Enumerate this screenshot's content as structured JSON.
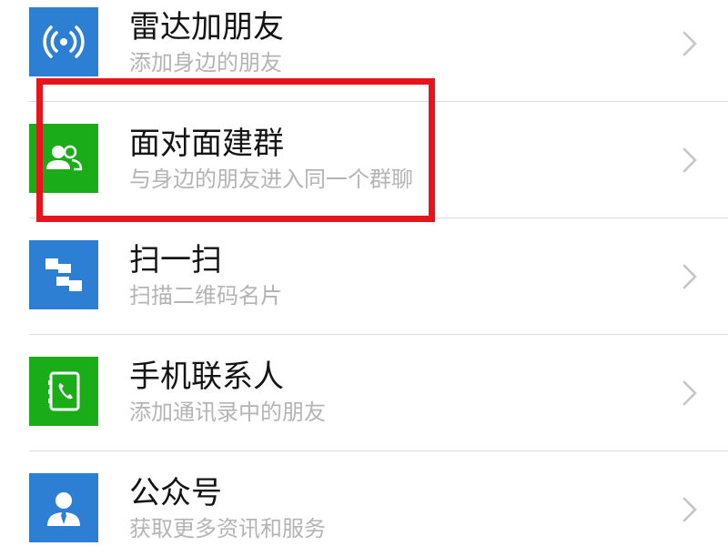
{
  "colors": {
    "blue_tile": "#2d7fd4",
    "green_tile": "#1aad19",
    "annotation_red": "#e8141b",
    "title_text": "#141414",
    "subtitle_text": "#b4b4b4",
    "divider": "#dcdcdc",
    "chevron": "#c6c6c6"
  },
  "items": [
    {
      "title": "雷达加朋友",
      "subtitle": "添加身边的朋友",
      "icon": "radar-icon",
      "icon_color": "#2d7fd4"
    },
    {
      "title": "面对面建群",
      "subtitle": "与身边的朋友进入同一个群聊",
      "icon": "face-to-face-group-icon",
      "icon_color": "#1aad19",
      "highlighted": true
    },
    {
      "title": "扫一扫",
      "subtitle": "扫描二维码名片",
      "icon": "scan-icon",
      "icon_color": "#2d7fd4"
    },
    {
      "title": "手机联系人",
      "subtitle": "添加通讯录中的朋友",
      "icon": "phone-contacts-icon",
      "icon_color": "#1aad19"
    },
    {
      "title": "公众号",
      "subtitle": "获取更多资讯和服务",
      "icon": "official-account-icon",
      "icon_color": "#2d7fd4"
    }
  ]
}
